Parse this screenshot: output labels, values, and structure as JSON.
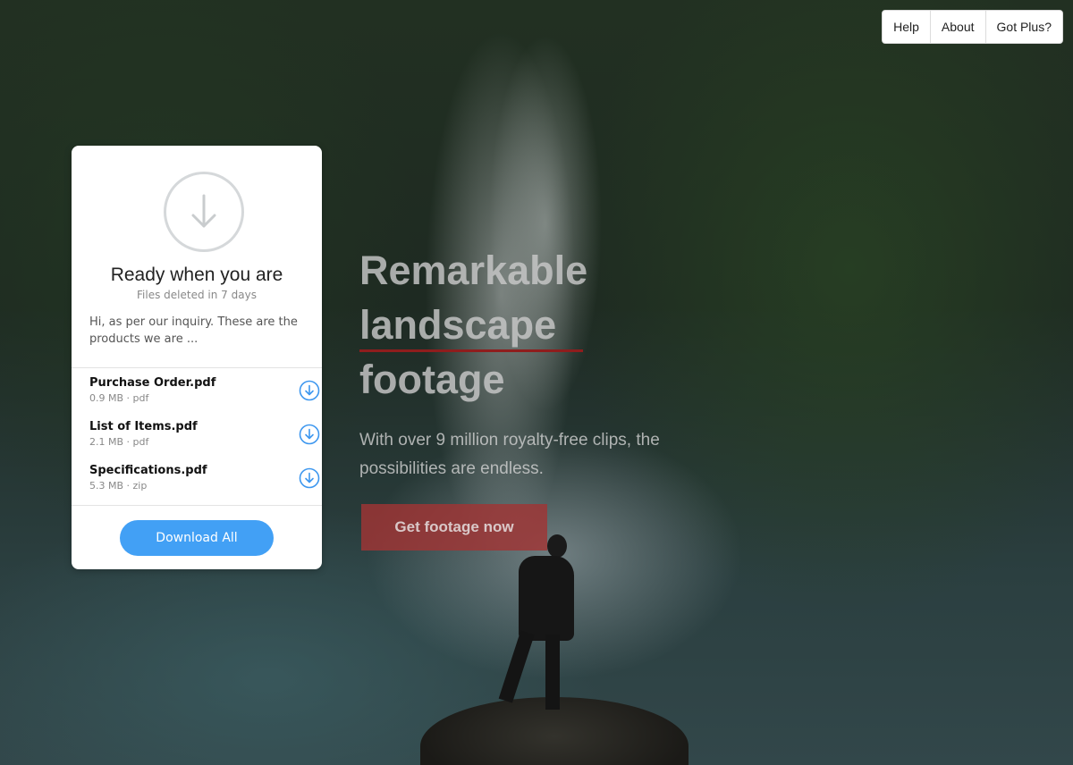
{
  "nav": {
    "items": [
      {
        "label": "Help"
      },
      {
        "label": "About"
      },
      {
        "label": "Got Plus?"
      }
    ]
  },
  "card": {
    "title": "Ready when you are",
    "subtitle": "Files deleted in 7 days",
    "message": "Hi, as per our inquiry. These are the products we are ...",
    "files": [
      {
        "name": "Purchase Order.pdf",
        "meta": "0.9 MB · pdf"
      },
      {
        "name": "List of Items.pdf",
        "meta": "2.1 MB · pdf"
      },
      {
        "name": "Specifications.pdf",
        "meta": "5.3 MB · zip"
      }
    ],
    "download_all_label": "Download All",
    "icon_big": "download-circle-icon",
    "icon_file": "download-circle-icon"
  },
  "hero": {
    "title_line1": "Remarkable",
    "title_line2": "landscape",
    "title_line3": "footage",
    "subtitle": "With over 9 million royalty-free clips, the possibilities are endless.",
    "cta_label": "Get footage now"
  },
  "colors": {
    "accent_blue": "#42a0f5",
    "cta_red": "#a03434",
    "underline_red": "#8f1d1d"
  }
}
